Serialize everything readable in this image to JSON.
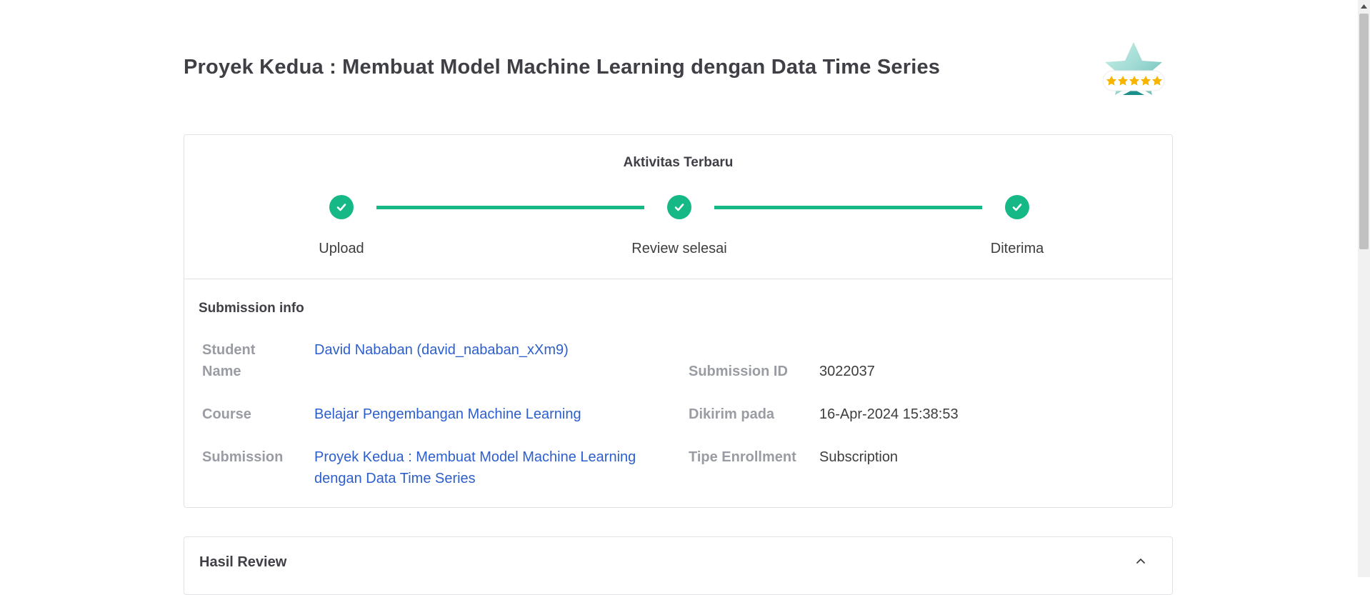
{
  "page": {
    "title": "Proyek Kedua : Membuat Model Machine Learning dengan Data Time Series"
  },
  "badge": {
    "icon": "star-rating-badge-icon",
    "rating": 5
  },
  "activity": {
    "title": "Aktivitas Terbaru",
    "steps": [
      {
        "label": "Upload",
        "status": "done"
      },
      {
        "label": "Review selesai",
        "status": "done"
      },
      {
        "label": "Diterima",
        "status": "done"
      }
    ],
    "accent_color": "#16b886"
  },
  "submission_info": {
    "title": "Submission info",
    "student_name_label": "Student Name",
    "student_name_label_line1": "Student",
    "student_name_label_line2": "Name",
    "student_name_value": "David Nababan (david_nababan_xXm9)",
    "course_label": "Course",
    "course_value": "Belajar Pengembangan Machine Learning",
    "submission_label": "Submission",
    "submission_value_line1": "Proyek Kedua : Membuat Model Machine Learning",
    "submission_value_line2": "dengan Data Time Series",
    "submission_id_label": "Submission ID",
    "submission_id_value": "3022037",
    "sent_at_label": "Dikirim pada",
    "sent_at_value": "16-Apr-2024 15:38:53",
    "enrollment_type_label": "Tipe Enrollment",
    "enrollment_type_value": "Subscription"
  },
  "review": {
    "title": "Hasil Review",
    "collapse_icon": "chevron-up-icon"
  },
  "colors": {
    "link": "#2d5fcc",
    "label_muted": "#9a9ca3",
    "star": "#f7b500",
    "border": "#e3e3e6"
  }
}
